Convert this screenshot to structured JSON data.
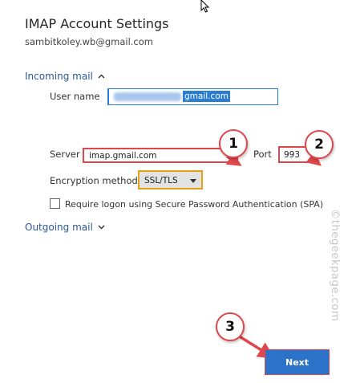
{
  "header": {
    "title": "IMAP Account Settings",
    "email": "sambitkoley.wb@gmail.com"
  },
  "incoming": {
    "toggle_label": "Incoming mail",
    "username_label": "User name",
    "username_domain": "gmail.com",
    "server_label": "Server",
    "server_value": "imap.gmail.com",
    "port_label": "Port",
    "port_value": "993",
    "encryption_label": "Encryption method",
    "encryption_value": "SSL/TLS",
    "spa_label": "Require logon using Secure Password Authentication (SPA)"
  },
  "outgoing": {
    "toggle_label": "Outgoing mail"
  },
  "annotations": {
    "step1": "1",
    "step2": "2",
    "step3": "3"
  },
  "footer": {
    "next_label": "Next"
  },
  "watermark": "©thegeekpage.com",
  "colors": {
    "accent": "#2b579a",
    "primary_button": "#2b72c8",
    "highlight_red": "#e0474c",
    "highlight_orange": "#e3a21a"
  }
}
